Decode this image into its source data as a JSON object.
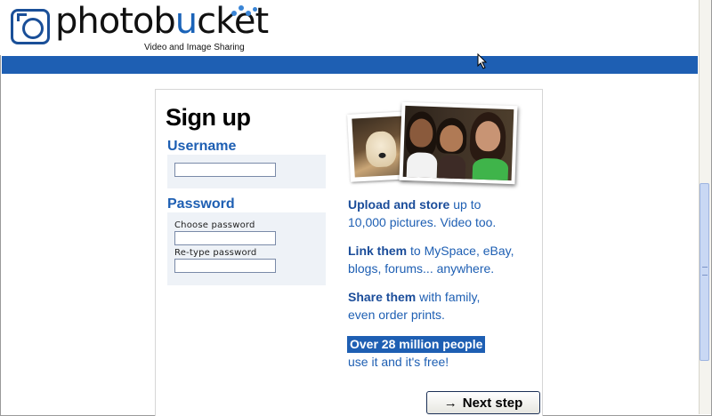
{
  "brand": {
    "name_plain": "photob",
    "name_accent": "u",
    "name_rest": "cket",
    "tagline": "Video and Image Sharing",
    "accent_color": "#1e5fb3"
  },
  "signup": {
    "title": "Sign up",
    "username": {
      "label": "Username",
      "value": ""
    },
    "password": {
      "label": "Password",
      "choose_label": "Choose password",
      "choose_value": "",
      "retype_label": "Re-type password",
      "retype_value": ""
    }
  },
  "marketing": {
    "items": [
      {
        "bold": "Upload and store",
        "rest": " up to",
        "line2": "10,000 pictures. Video too."
      },
      {
        "bold": "Link them",
        "rest": " to MySpace, eBay,",
        "line2": "blogs, forums... anywhere."
      },
      {
        "bold": "Share them",
        "rest": " with family,",
        "line2": "even order prints."
      }
    ],
    "highlight": "Over 28 million people",
    "highlight_sub": "use it and it's free!"
  },
  "next_button": {
    "arrow": "→",
    "label": "Next step"
  }
}
